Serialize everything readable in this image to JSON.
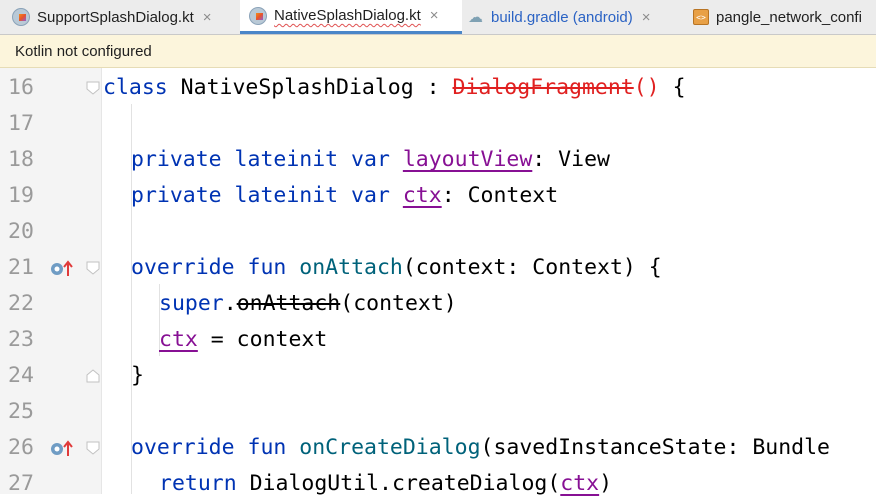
{
  "tabs": [
    {
      "label": "SupportSplashDialog.kt",
      "icon": "kotlin-file-icon",
      "close": "×"
    },
    {
      "label": "NativeSplashDialog.kt",
      "icon": "kotlin-file-icon",
      "close": "×",
      "active": true
    },
    {
      "label": "build.gradle (android)",
      "icon": "gradle-elephant-icon",
      "close": "×"
    },
    {
      "label": "pangle_network_confi",
      "icon": "xml-file-icon",
      "glyph": "<>"
    }
  ],
  "banner": {
    "text": "Kotlin not configured"
  },
  "editor": {
    "line_numbers": [
      "16",
      "17",
      "18",
      "19",
      "20",
      "21",
      "22",
      "23",
      "24",
      "25",
      "26",
      "27"
    ],
    "code": {
      "l16": {
        "kw": "class",
        "name": " NativeSplashDialog : ",
        "parent": "DialogFragment",
        "paren": "()",
        "brace": " {"
      },
      "l18": {
        "kw": "private lateinit var",
        "prop": "layoutView",
        "rest": ": View"
      },
      "l19": {
        "kw": "private lateinit var",
        "prop": "ctx",
        "rest": ": Context"
      },
      "l21": {
        "kw": "override fun",
        "fn": "onAttach",
        "rest": "(context: Context) {"
      },
      "l22": {
        "kw": "super",
        "dot": ".",
        "call": "onAttach",
        "rest": "(context)"
      },
      "l23": {
        "prop": "ctx",
        "rest": " = context"
      },
      "l24": {
        "text": "}"
      },
      "l26": {
        "kw": "override fun",
        "fn": "onCreateDialog",
        "rest": "(savedInstanceState: Bundle"
      },
      "l27": {
        "kw": "return",
        "rest": " DialogUtil.createDialog(",
        "prop": "ctx",
        "close": ")"
      }
    }
  },
  "colors": {
    "keyword": "#0033b3",
    "function": "#00627a",
    "property": "#871094",
    "error": "#e02020",
    "accent": "#4a86c8"
  }
}
